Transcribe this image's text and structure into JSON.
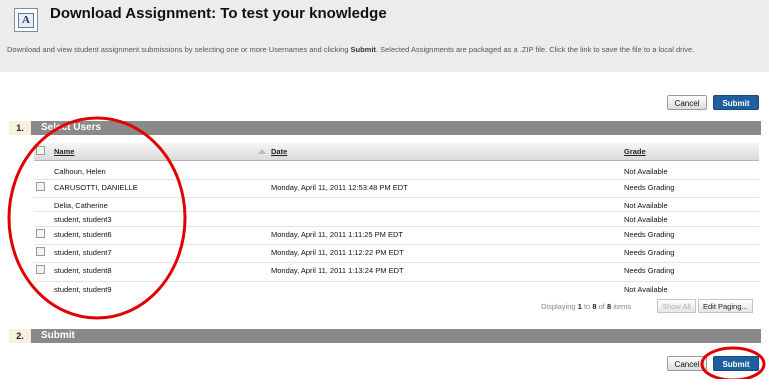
{
  "header": {
    "title": "Download Assignment: To test your knowledge",
    "icon": "assignment-icon",
    "icon_glyph": "A",
    "description_before": "Download and view student assignment submissions by selecting one or more Usernames and clicking ",
    "description_bold": "Submit",
    "description_after": ". Selected Assignments are packaged as a .ZIP file. Click the link to save the file to a local drive."
  },
  "buttons": {
    "cancel": "Cancel",
    "submit": "Submit"
  },
  "step1": {
    "number": "1.",
    "label": "Select Users"
  },
  "step2": {
    "number": "2.",
    "label": "Submit"
  },
  "table": {
    "columns": {
      "name": "Name",
      "date": "Date",
      "grade": "Grade"
    },
    "rows": [
      {
        "name": "Calhoun, Helen",
        "date": "",
        "grade": "Not Available"
      },
      {
        "name": "CARUSOTTI, DANIELLE",
        "date": "Monday, April 11, 2011 12:53:48 PM EDT",
        "grade": "Needs Grading"
      },
      {
        "name": "Delia, Catherine",
        "date": "",
        "grade": "Not Available"
      },
      {
        "name": "student, student3",
        "date": "",
        "grade": "Not Available"
      },
      {
        "name": "student, student6",
        "date": "Monday, April 11, 2011 1:11:25 PM EDT",
        "grade": "Needs Grading"
      },
      {
        "name": "student, student7",
        "date": "Monday, April 11, 2011 1:12:22 PM EDT",
        "grade": "Needs Grading"
      },
      {
        "name": "student, student8",
        "date": "Monday, April 11, 2011 1:13:24 PM EDT",
        "grade": "Needs Grading"
      },
      {
        "name": "student, student9",
        "date": "",
        "grade": "Not Available"
      }
    ]
  },
  "paging": {
    "displaying": "Displaying",
    "from": "1",
    "to_word": "to",
    "to": "8",
    "of_word": "of",
    "total": "8",
    "items": "items",
    "show_all": "Show All",
    "edit_paging": "Edit Paging..."
  },
  "annotation_color": "#e00000"
}
